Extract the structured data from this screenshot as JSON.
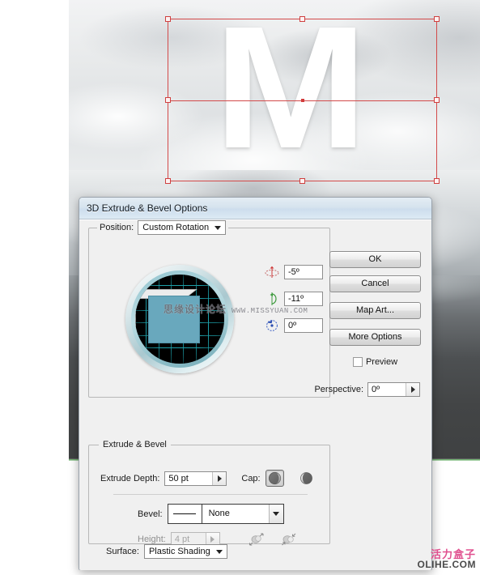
{
  "canvas": {
    "letter": "M",
    "selection_label": "selection-bounding-box"
  },
  "dialog": {
    "title": "3D Extrude & Bevel Options",
    "position": {
      "label": "Position:",
      "value": "Custom Rotation"
    },
    "rotation": {
      "x_axis": {
        "icon": "rotate-x-icon",
        "value": "-5º"
      },
      "y_axis": {
        "icon": "rotate-y-icon",
        "value": "-11º"
      },
      "z_axis": {
        "icon": "rotate-z-icon",
        "value": "0º"
      }
    },
    "perspective": {
      "label": "Perspective:",
      "value": "0º"
    },
    "extrude_bevel": {
      "legend": "Extrude & Bevel",
      "extrude_depth_label": "Extrude Depth:",
      "extrude_depth_value": "50 pt",
      "cap_label": "Cap:",
      "cap_on_icon": "cap-solid-icon",
      "cap_off_icon": "cap-hollow-icon",
      "bevel_label": "Bevel:",
      "bevel_value": "None",
      "height_label": "Height:",
      "height_value": "4 pt",
      "bevel_dir_out_icon": "bevel-extent-out-icon",
      "bevel_dir_in_icon": "bevel-extent-in-icon"
    },
    "surface": {
      "label": "Surface:",
      "value": "Plastic Shading"
    },
    "buttons": {
      "ok": "OK",
      "cancel": "Cancel",
      "map_art": "Map Art...",
      "more_options": "More Options",
      "preview": "Preview"
    }
  },
  "watermarks": {
    "sphere_cn": "思缘设计论坛",
    "sphere_en": "WWW.MISSYUAN.COM",
    "logo_cn": "活力盒子",
    "logo_en": "OLIHE.COM"
  },
  "colors": {
    "selection": "#d34a4a",
    "cube": "#69a8bd",
    "grid": "#1d9fa8",
    "logo_pink": "#e0508f"
  }
}
